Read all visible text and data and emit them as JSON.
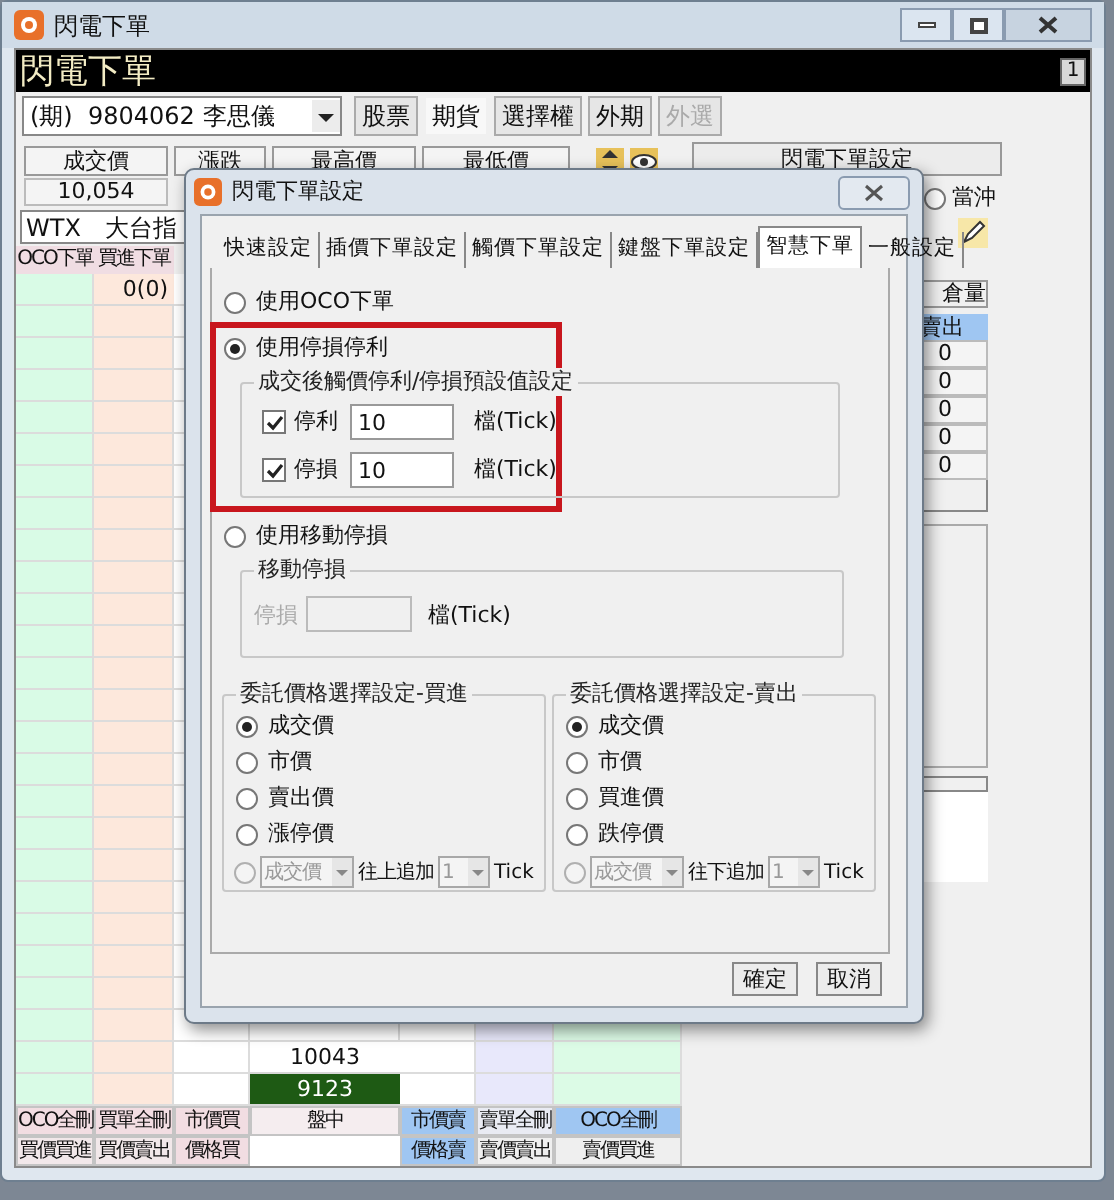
{
  "window": {
    "title": "閃電下單"
  },
  "header": {
    "title": "閃電下單",
    "badge": "1"
  },
  "account": {
    "value": "(期)  9804062 李思儀"
  },
  "market_tabs": [
    {
      "label": "股票",
      "selected": false,
      "disabled": false
    },
    {
      "label": "期貨",
      "selected": true,
      "disabled": false
    },
    {
      "label": "選擇權",
      "selected": false,
      "disabled": false
    },
    {
      "label": "外期",
      "selected": false,
      "disabled": false
    },
    {
      "label": "外選",
      "selected": false,
      "disabled": true
    }
  ],
  "quote": {
    "columns": [
      "成交價",
      "漲跌",
      "最高價",
      "最低價"
    ],
    "last_price": "10,054"
  },
  "settings_button": "閃電下單設定",
  "day_trade": {
    "label": "當沖",
    "selected": false
  },
  "symbol": {
    "code": "WTX",
    "name": "大台指"
  },
  "ladder": {
    "columns": [
      "OCO下單",
      "買進下單"
    ],
    "position": "0(0)",
    "prices": [
      {
        "price": "10043",
        "selected": false
      },
      {
        "price": "9123",
        "selected": true
      }
    ]
  },
  "action_rows": [
    [
      {
        "kind": "button",
        "label": "OCO全刪",
        "color": "#f2dde2"
      },
      {
        "kind": "button",
        "label": "買單全刪",
        "color": "#f2dde2"
      },
      {
        "kind": "button",
        "label": "市價買",
        "color": "#f2dde2"
      },
      {
        "kind": "button",
        "label": "盤中",
        "color": "#f5edef"
      },
      {
        "kind": "button",
        "label": "市價賣",
        "color": "#9fc6f2"
      },
      {
        "kind": "button",
        "label": "賣單全刪",
        "color": "#e9ebf3"
      },
      {
        "kind": "button",
        "label": "OCO全刪",
        "color": "#9fc6f2"
      }
    ],
    [
      {
        "kind": "button",
        "label": "買價買進",
        "color": "#f2e8ea"
      },
      {
        "kind": "button",
        "label": "買價賣出",
        "color": "#f2e8ea"
      },
      {
        "kind": "button",
        "label": "價格買",
        "color": "#f2dde2"
      },
      {
        "kind": "blank"
      },
      {
        "kind": "button",
        "label": "價格賣",
        "color": "#9fc6f2"
      },
      {
        "kind": "button",
        "label": "賣價賣出",
        "color": "#efefef"
      },
      {
        "kind": "button",
        "label": "賣價買進",
        "color": "#efefef"
      }
    ]
  ],
  "position_panel": {
    "header": "倉量",
    "subheader": "賣出",
    "values": [
      "0",
      "0",
      "0",
      "0",
      "0"
    ]
  },
  "dialog": {
    "title": "閃電下單設定",
    "tabs": [
      {
        "label": "快速設定",
        "selected": false
      },
      {
        "label": "插價下單設定",
        "selected": false
      },
      {
        "label": "觸價下單設定",
        "selected": false
      },
      {
        "label": "鍵盤下單設定",
        "selected": false
      },
      {
        "label": "智慧下單",
        "selected": true
      },
      {
        "label": "一般設定",
        "selected": false
      }
    ],
    "modes": [
      {
        "label": "使用OCO下單",
        "selected": false,
        "highlighted": false
      },
      {
        "label": "使用停損停利",
        "selected": true,
        "highlighted": true
      },
      {
        "label": "使用移動停損",
        "selected": false,
        "highlighted": false
      }
    ],
    "stop_group": {
      "title": "成交後觸價停利/停損預設值設定",
      "rows": [
        {
          "label": "停利",
          "checked": true,
          "value": "10",
          "unit": "檔(Tick)"
        },
        {
          "label": "停損",
          "checked": true,
          "value": "10",
          "unit": "檔(Tick)"
        }
      ]
    },
    "trailing_group": {
      "title": "移動停損",
      "label": "停損",
      "unit": "檔(Tick)",
      "disabled": true
    },
    "price_groups": [
      {
        "title": "委託價格選擇設定-買進",
        "options": [
          {
            "label": "成交價",
            "selected": true
          },
          {
            "label": "市價",
            "selected": false
          },
          {
            "label": "賣出價",
            "selected": false
          },
          {
            "label": "漲停價",
            "selected": false
          }
        ],
        "custom": {
          "selected": false,
          "base": "成交價",
          "direction": "往上追加",
          "ticks": "1",
          "unit": "Tick"
        }
      },
      {
        "title": "委託價格選擇設定-賣出",
        "options": [
          {
            "label": "成交價",
            "selected": true
          },
          {
            "label": "市價",
            "selected": false
          },
          {
            "label": "買進價",
            "selected": false
          },
          {
            "label": "跌停價",
            "selected": false
          }
        ],
        "custom": {
          "selected": false,
          "base": "成交價",
          "direction": "往下追加",
          "ticks": "1",
          "unit": "Tick"
        }
      }
    ],
    "buttons": [
      "確定",
      "取消"
    ]
  }
}
